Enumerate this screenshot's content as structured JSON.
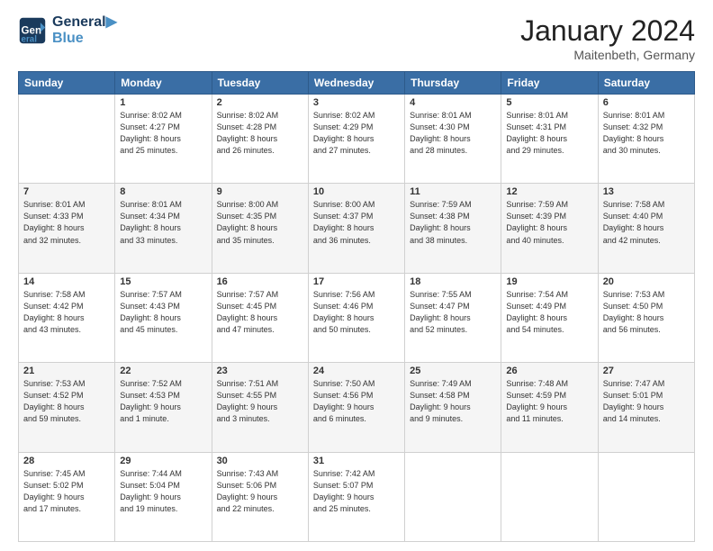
{
  "header": {
    "logo_line1": "General",
    "logo_line2": "Blue",
    "month": "January 2024",
    "location": "Maitenbeth, Germany"
  },
  "weekdays": [
    "Sunday",
    "Monday",
    "Tuesday",
    "Wednesday",
    "Thursday",
    "Friday",
    "Saturday"
  ],
  "weeks": [
    [
      {
        "day": "",
        "content": ""
      },
      {
        "day": "1",
        "content": "Sunrise: 8:02 AM\nSunset: 4:27 PM\nDaylight: 8 hours\nand 25 minutes."
      },
      {
        "day": "2",
        "content": "Sunrise: 8:02 AM\nSunset: 4:28 PM\nDaylight: 8 hours\nand 26 minutes."
      },
      {
        "day": "3",
        "content": "Sunrise: 8:02 AM\nSunset: 4:29 PM\nDaylight: 8 hours\nand 27 minutes."
      },
      {
        "day": "4",
        "content": "Sunrise: 8:01 AM\nSunset: 4:30 PM\nDaylight: 8 hours\nand 28 minutes."
      },
      {
        "day": "5",
        "content": "Sunrise: 8:01 AM\nSunset: 4:31 PM\nDaylight: 8 hours\nand 29 minutes."
      },
      {
        "day": "6",
        "content": "Sunrise: 8:01 AM\nSunset: 4:32 PM\nDaylight: 8 hours\nand 30 minutes."
      }
    ],
    [
      {
        "day": "7",
        "content": "Sunrise: 8:01 AM\nSunset: 4:33 PM\nDaylight: 8 hours\nand 32 minutes."
      },
      {
        "day": "8",
        "content": "Sunrise: 8:01 AM\nSunset: 4:34 PM\nDaylight: 8 hours\nand 33 minutes."
      },
      {
        "day": "9",
        "content": "Sunrise: 8:00 AM\nSunset: 4:35 PM\nDaylight: 8 hours\nand 35 minutes."
      },
      {
        "day": "10",
        "content": "Sunrise: 8:00 AM\nSunset: 4:37 PM\nDaylight: 8 hours\nand 36 minutes."
      },
      {
        "day": "11",
        "content": "Sunrise: 7:59 AM\nSunset: 4:38 PM\nDaylight: 8 hours\nand 38 minutes."
      },
      {
        "day": "12",
        "content": "Sunrise: 7:59 AM\nSunset: 4:39 PM\nDaylight: 8 hours\nand 40 minutes."
      },
      {
        "day": "13",
        "content": "Sunrise: 7:58 AM\nSunset: 4:40 PM\nDaylight: 8 hours\nand 42 minutes."
      }
    ],
    [
      {
        "day": "14",
        "content": "Sunrise: 7:58 AM\nSunset: 4:42 PM\nDaylight: 8 hours\nand 43 minutes."
      },
      {
        "day": "15",
        "content": "Sunrise: 7:57 AM\nSunset: 4:43 PM\nDaylight: 8 hours\nand 45 minutes."
      },
      {
        "day": "16",
        "content": "Sunrise: 7:57 AM\nSunset: 4:45 PM\nDaylight: 8 hours\nand 47 minutes."
      },
      {
        "day": "17",
        "content": "Sunrise: 7:56 AM\nSunset: 4:46 PM\nDaylight: 8 hours\nand 50 minutes."
      },
      {
        "day": "18",
        "content": "Sunrise: 7:55 AM\nSunset: 4:47 PM\nDaylight: 8 hours\nand 52 minutes."
      },
      {
        "day": "19",
        "content": "Sunrise: 7:54 AM\nSunset: 4:49 PM\nDaylight: 8 hours\nand 54 minutes."
      },
      {
        "day": "20",
        "content": "Sunrise: 7:53 AM\nSunset: 4:50 PM\nDaylight: 8 hours\nand 56 minutes."
      }
    ],
    [
      {
        "day": "21",
        "content": "Sunrise: 7:53 AM\nSunset: 4:52 PM\nDaylight: 8 hours\nand 59 minutes."
      },
      {
        "day": "22",
        "content": "Sunrise: 7:52 AM\nSunset: 4:53 PM\nDaylight: 9 hours\nand 1 minute."
      },
      {
        "day": "23",
        "content": "Sunrise: 7:51 AM\nSunset: 4:55 PM\nDaylight: 9 hours\nand 3 minutes."
      },
      {
        "day": "24",
        "content": "Sunrise: 7:50 AM\nSunset: 4:56 PM\nDaylight: 9 hours\nand 6 minutes."
      },
      {
        "day": "25",
        "content": "Sunrise: 7:49 AM\nSunset: 4:58 PM\nDaylight: 9 hours\nand 9 minutes."
      },
      {
        "day": "26",
        "content": "Sunrise: 7:48 AM\nSunset: 4:59 PM\nDaylight: 9 hours\nand 11 minutes."
      },
      {
        "day": "27",
        "content": "Sunrise: 7:47 AM\nSunset: 5:01 PM\nDaylight: 9 hours\nand 14 minutes."
      }
    ],
    [
      {
        "day": "28",
        "content": "Sunrise: 7:45 AM\nSunset: 5:02 PM\nDaylight: 9 hours\nand 17 minutes."
      },
      {
        "day": "29",
        "content": "Sunrise: 7:44 AM\nSunset: 5:04 PM\nDaylight: 9 hours\nand 19 minutes."
      },
      {
        "day": "30",
        "content": "Sunrise: 7:43 AM\nSunset: 5:06 PM\nDaylight: 9 hours\nand 22 minutes."
      },
      {
        "day": "31",
        "content": "Sunrise: 7:42 AM\nSunset: 5:07 PM\nDaylight: 9 hours\nand 25 minutes."
      },
      {
        "day": "",
        "content": ""
      },
      {
        "day": "",
        "content": ""
      },
      {
        "day": "",
        "content": ""
      }
    ]
  ]
}
